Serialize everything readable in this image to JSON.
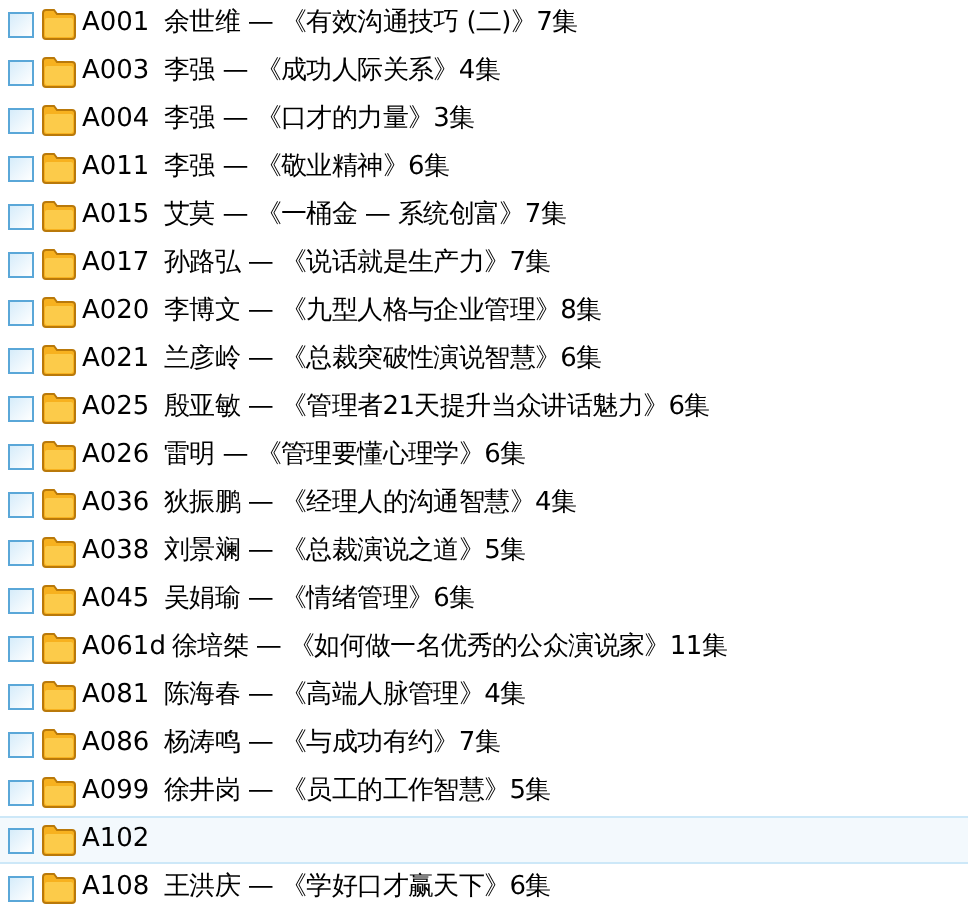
{
  "items": [
    {
      "code": "A001",
      "title": "余世维 — 《有效沟通技巧 (二)》7集",
      "checked": false,
      "selected": false
    },
    {
      "code": "A003",
      "title": "李强 — 《成功人际关系》4集",
      "checked": false,
      "selected": false
    },
    {
      "code": "A004",
      "title": "李强 — 《口才的力量》3集",
      "checked": false,
      "selected": false
    },
    {
      "code": "A011",
      "title": "李强 — 《敬业精神》6集",
      "checked": false,
      "selected": false
    },
    {
      "code": "A015",
      "title": "艾莫 — 《一桶金 — 系统创富》7集",
      "checked": false,
      "selected": false
    },
    {
      "code": "A017",
      "title": "孙路弘 — 《说话就是生产力》7集",
      "checked": false,
      "selected": false
    },
    {
      "code": "A020",
      "title": "李博文 — 《九型人格与企业管理》8集",
      "checked": false,
      "selected": false
    },
    {
      "code": "A021",
      "title": "兰彦岭 — 《总裁突破性演说智慧》6集",
      "checked": false,
      "selected": false
    },
    {
      "code": "A025",
      "title": "殷亚敏 — 《管理者21天提升当众讲话魅力》6集",
      "checked": false,
      "selected": false
    },
    {
      "code": "A026",
      "title": "雷明 — 《管理要懂心理学》6集",
      "checked": false,
      "selected": false
    },
    {
      "code": "A036",
      "title": "狄振鹏 — 《经理人的沟通智慧》4集",
      "checked": false,
      "selected": false
    },
    {
      "code": "A038",
      "title": "刘景斓 — 《总裁演说之道》5集",
      "checked": false,
      "selected": false
    },
    {
      "code": "A045",
      "title": "吴娟瑜 — 《情绪管理》6集",
      "checked": false,
      "selected": false
    },
    {
      "code": "A061d",
      "title": "徐培桀 — 《如何做一名优秀的公众演说家》11集",
      "checked": false,
      "selected": false
    },
    {
      "code": "A081",
      "title": "陈海春 — 《高端人脉管理》4集",
      "checked": false,
      "selected": false
    },
    {
      "code": "A086",
      "title": "杨涛鸣 — 《与成功有约》7集",
      "checked": false,
      "selected": false
    },
    {
      "code": "A099",
      "title": "徐井岗 — 《员工的工作智慧》5集",
      "checked": false,
      "selected": false
    },
    {
      "code": "A102",
      "checked": false,
      "selected": true
    },
    {
      "code": "A108",
      "title": "王洪庆 — 《学好口才赢天下》6集",
      "checked": false,
      "selected": false
    }
  ]
}
